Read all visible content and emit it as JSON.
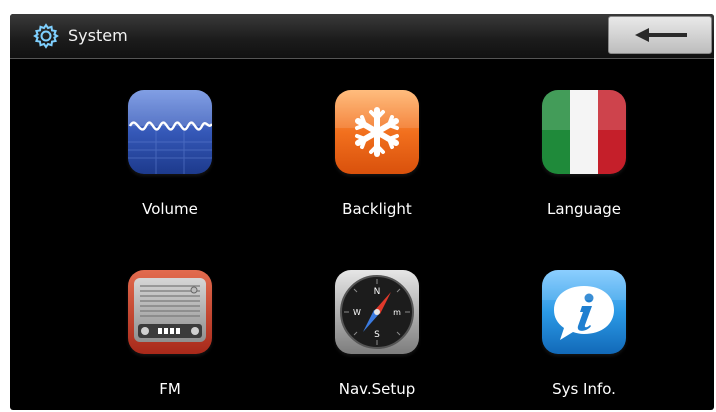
{
  "header": {
    "title": "System",
    "icon": "gear-icon",
    "back_icon": "arrow-left-icon"
  },
  "apps": [
    {
      "label": "Volume",
      "icon": "waveform-icon",
      "color": "#2f4fa8"
    },
    {
      "label": "Backlight",
      "icon": "snowflake-icon",
      "color": "#f36a1c"
    },
    {
      "label": "Language",
      "icon": "italian-flag-icon",
      "color": "#c8232c"
    },
    {
      "label": "FM",
      "icon": "radio-icon",
      "color": "#c23b22"
    },
    {
      "label": "Nav.Setup",
      "icon": "compass-icon",
      "color": "#9a9a9a"
    },
    {
      "label": "Sys Info.",
      "icon": "info-bubble-icon",
      "color": "#1e8fe0"
    }
  ],
  "compass_letters": {
    "north": "N",
    "south": "S",
    "east": "m",
    "west": "W"
  }
}
